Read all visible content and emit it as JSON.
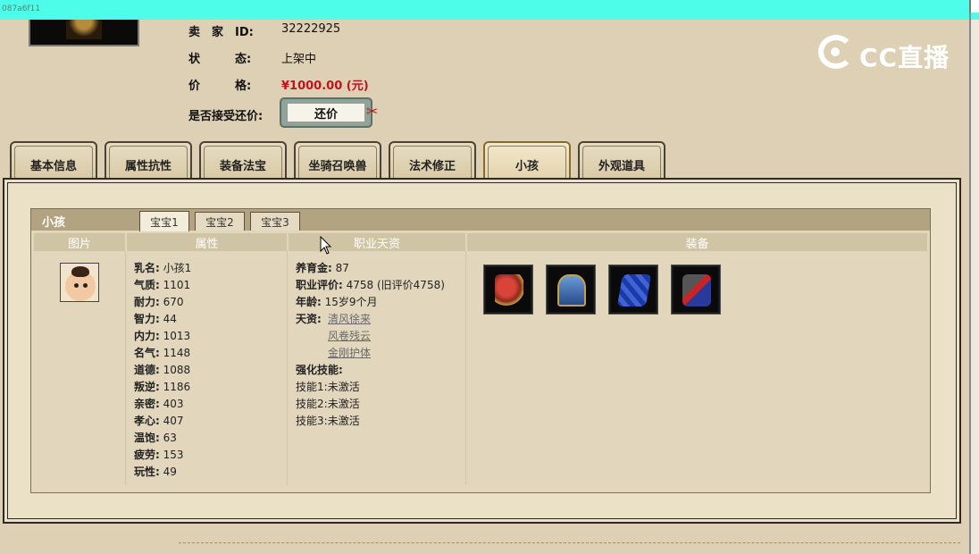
{
  "topbar": {
    "tiny_text": "087a6f11"
  },
  "seller": {
    "id_label": "卖　家　ID:",
    "id_value": "32222925",
    "status_label": "状　　　态:",
    "status_value": "上架中",
    "price_label": "价　　　格:",
    "price_value": "¥1000.00 (元)",
    "bargain_label": "是否接受还价:",
    "bargain_button": "还价"
  },
  "logo": {
    "text": "CC直播"
  },
  "tabs": [
    "基本信息",
    "属性抗性",
    "装备法宝",
    "坐骑召唤兽",
    "法术修正",
    "小孩",
    "外观道具"
  ],
  "active_tab": "小孩",
  "child_box": {
    "title": "小孩",
    "subtabs": [
      "宝宝1",
      "宝宝2",
      "宝宝3"
    ],
    "columns": [
      "图片",
      "属性",
      "职业天资",
      "装备"
    ]
  },
  "attributes": [
    {
      "k": "乳名:",
      "v": "小孩1"
    },
    {
      "k": "气质:",
      "v": "1101"
    },
    {
      "k": "耐力:",
      "v": "670"
    },
    {
      "k": "智力:",
      "v": "44"
    },
    {
      "k": "内力:",
      "v": "1013"
    },
    {
      "k": "名气:",
      "v": "1148"
    },
    {
      "k": "道德:",
      "v": "1088"
    },
    {
      "k": "叛逆:",
      "v": "1186"
    },
    {
      "k": "亲密:",
      "v": "403"
    },
    {
      "k": "孝心:",
      "v": "407"
    },
    {
      "k": "温饱:",
      "v": "63"
    },
    {
      "k": "疲劳:",
      "v": "153"
    },
    {
      "k": "玩性:",
      "v": "49"
    }
  ],
  "career": {
    "fund_k": "养育金:",
    "fund_v": "87",
    "eval_k": "职业评价:",
    "eval_v": "4758 (旧评价4758)",
    "age_k": "年龄:",
    "age_v": "15岁9个月",
    "talent_k": "天资:",
    "talents": [
      "清风徐来",
      "风卷残云",
      "金刚护体"
    ],
    "enhance_k": "强化技能:",
    "skills": [
      {
        "k": "技能1:",
        "v": "未激活"
      },
      {
        "k": "技能2:",
        "v": "未激活"
      },
      {
        "k": "技能3:",
        "v": "未激活"
      }
    ]
  },
  "equipment_icons": [
    "armor-red-icon",
    "robe-blue-icon",
    "book-blue-icon",
    "gear-box-icon"
  ]
}
